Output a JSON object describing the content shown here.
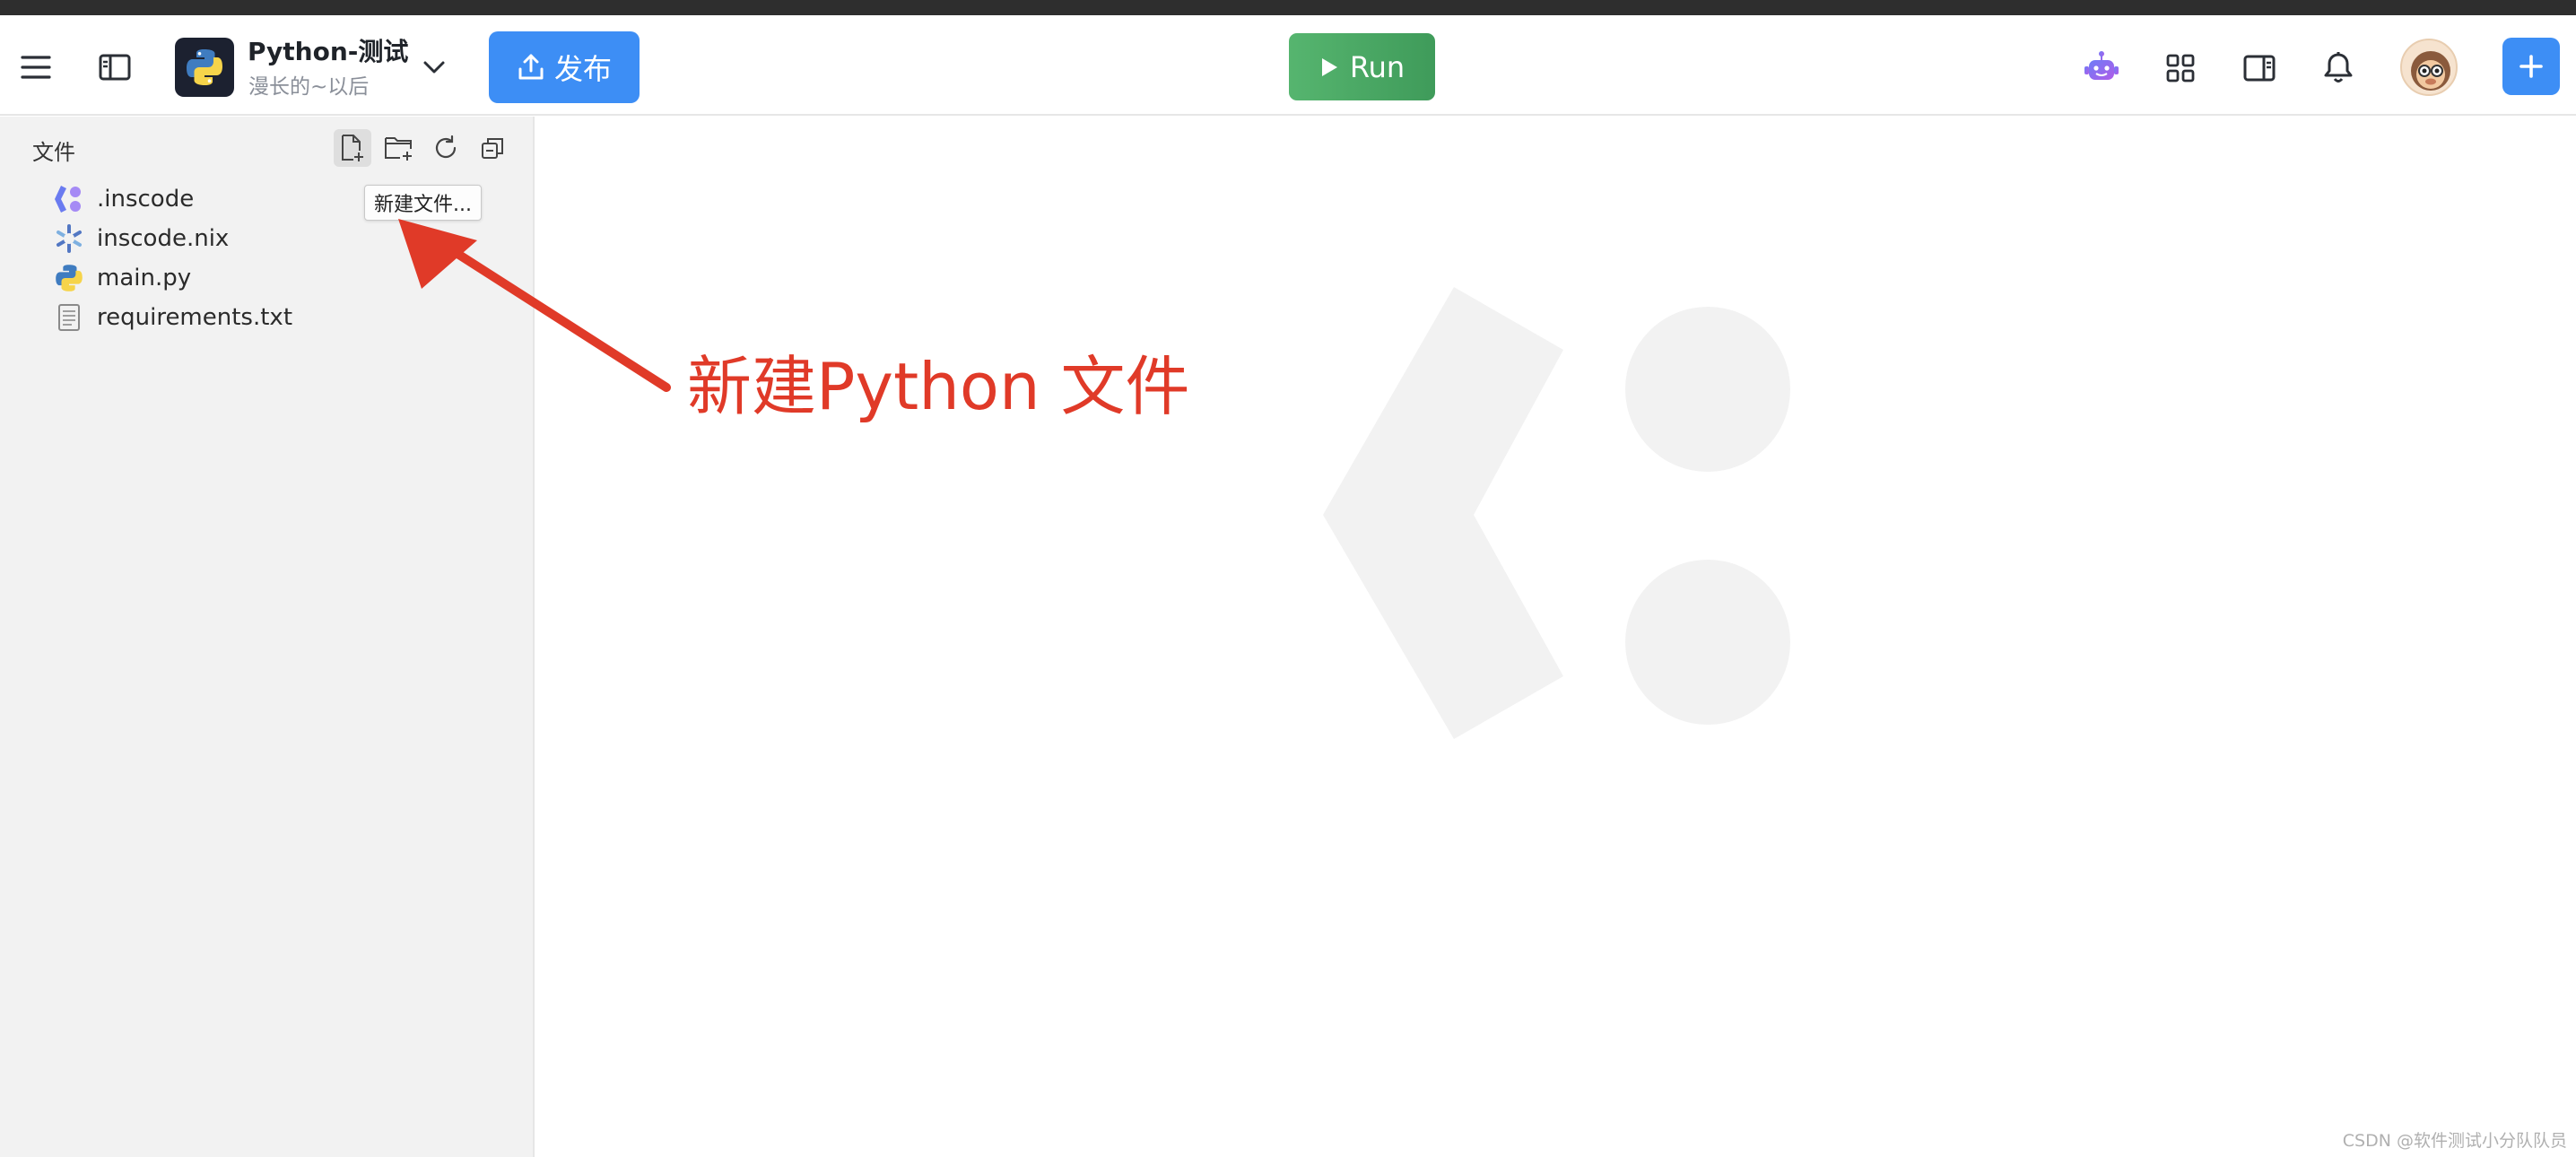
{
  "header": {
    "project_title": "Python-测试",
    "project_subtitle": "漫长的~以后",
    "publish_label": "发布",
    "run_label": "Run"
  },
  "sidebar": {
    "title": "文件",
    "files": [
      {
        "name": ".inscode",
        "icon": "inscode-icon"
      },
      {
        "name": "inscode.nix",
        "icon": "nix-icon"
      },
      {
        "name": "main.py",
        "icon": "python-file-icon"
      },
      {
        "name": "requirements.txt",
        "icon": "text-file-icon"
      }
    ],
    "tooltip": "新建文件..."
  },
  "annotation": {
    "text": "新建Python 文件",
    "color": "#e03a28"
  },
  "footer": {
    "watermark": "CSDN @软件测试小分队队员"
  },
  "colors": {
    "accent": "#3d8ef5",
    "run": "#4aa864"
  }
}
